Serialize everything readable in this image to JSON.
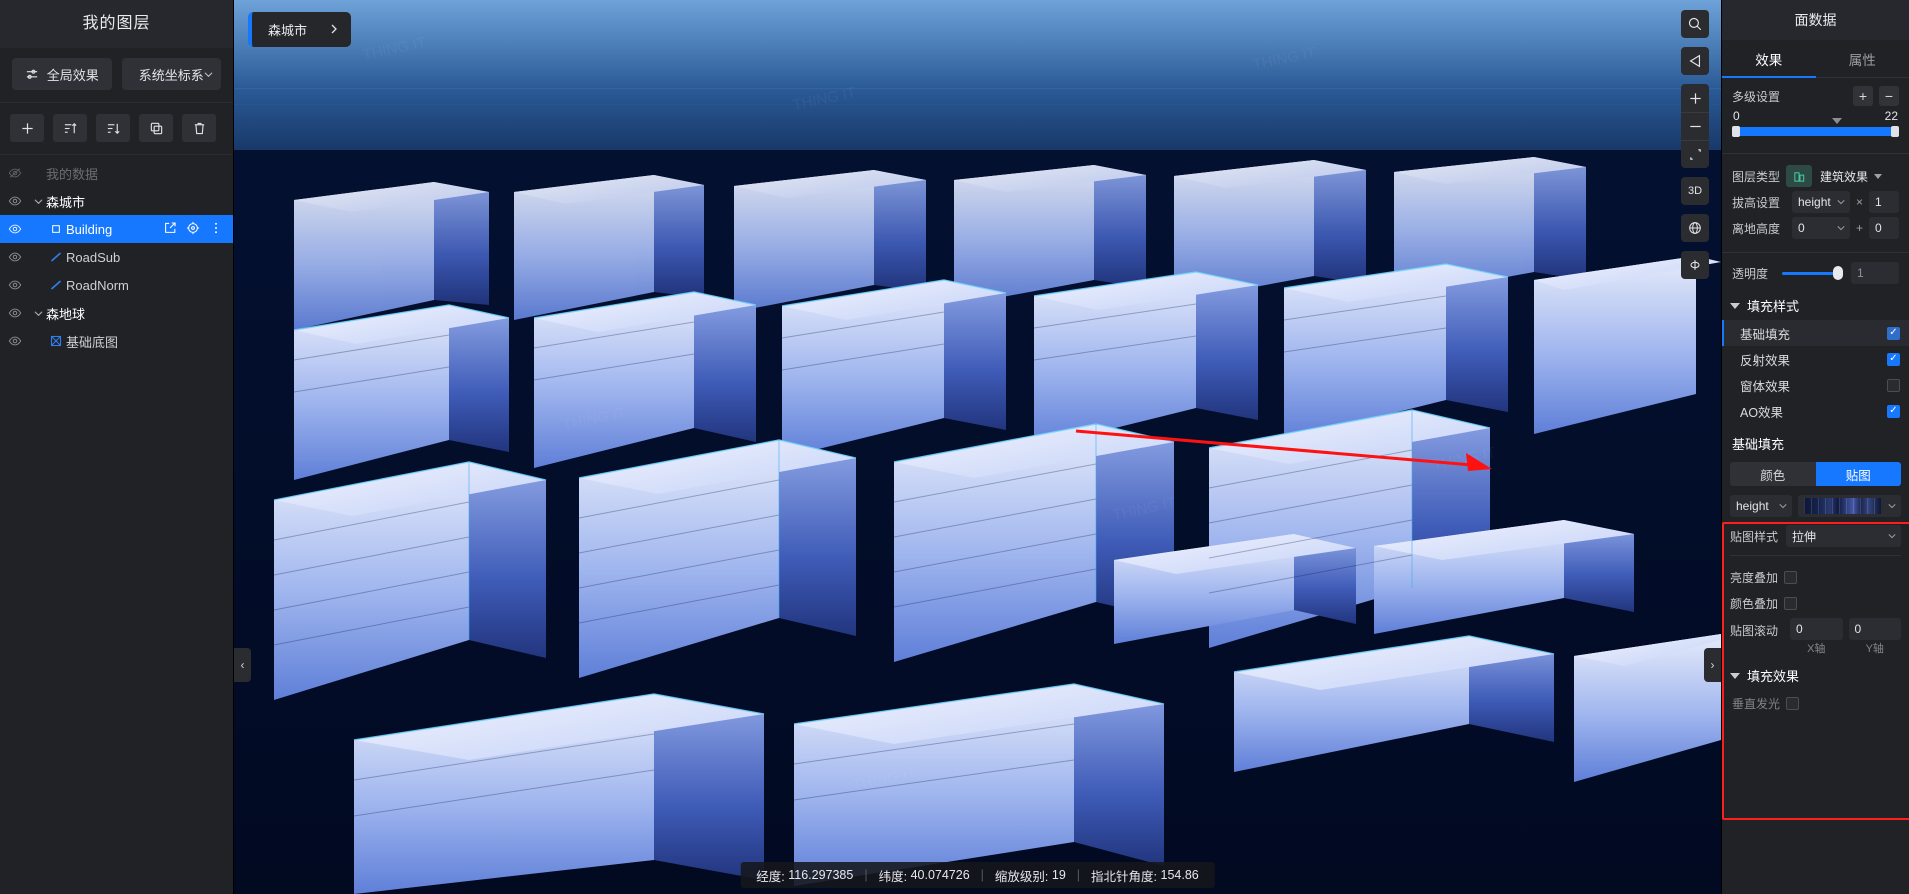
{
  "sidebar": {
    "title": "我的图层",
    "actions": [
      {
        "label": "全局效果",
        "icon": "sliders-icon"
      },
      {
        "label": "系统坐标系",
        "icon": "chevron-down-icon"
      }
    ],
    "tools": [
      {
        "name": "add-layer-button",
        "icon": "plus-icon"
      },
      {
        "name": "sort-asc-button",
        "icon": "sort-asc-icon"
      },
      {
        "name": "sort-desc-button",
        "icon": "sort-desc-icon"
      },
      {
        "name": "copy-button",
        "icon": "copy-icon"
      },
      {
        "name": "delete-button",
        "icon": "trash-icon"
      }
    ],
    "layers": [
      {
        "name": "我的数据",
        "level": 0,
        "visible": false,
        "hasCaret": false,
        "typeIcon": "none",
        "selected": false,
        "dim": true
      },
      {
        "name": "森城市",
        "level": 0,
        "visible": true,
        "hasCaret": true,
        "typeIcon": "none",
        "selected": false,
        "dim": false
      },
      {
        "name": "Building",
        "level": 1,
        "visible": true,
        "hasCaret": false,
        "typeIcon": "polygon-icon",
        "selected": true,
        "dim": false
      },
      {
        "name": "RoadSub",
        "level": 1,
        "visible": true,
        "hasCaret": false,
        "typeIcon": "line-icon",
        "selected": false,
        "dim": false
      },
      {
        "name": "RoadNorm",
        "level": 1,
        "visible": true,
        "hasCaret": false,
        "typeIcon": "line-icon",
        "selected": false,
        "dim": false
      },
      {
        "name": "森地球",
        "level": 0,
        "visible": true,
        "hasCaret": true,
        "typeIcon": "none",
        "selected": false,
        "dim": false
      },
      {
        "name": "基础底图",
        "level": 1,
        "visible": true,
        "hasCaret": false,
        "typeIcon": "raster-icon",
        "selected": false,
        "dim": false
      }
    ]
  },
  "map": {
    "breadcrumb": "森城市",
    "toolbar": [
      {
        "name": "search-icon"
      },
      {
        "name": "measure-icon"
      },
      {
        "name": "zoom-in-icon"
      },
      {
        "name": "zoom-out-icon"
      },
      {
        "name": "fullscreen-icon"
      },
      {
        "name": "3d-toggle",
        "label": "3D"
      },
      {
        "name": "globe-icon"
      },
      {
        "name": "rotate-icon"
      }
    ],
    "status": {
      "longitude_label": "经度:",
      "longitude": "116.297385",
      "latitude_label": "纬度:",
      "latitude": "40.074726",
      "zoom_label": "缩放级别:",
      "zoom": "19",
      "bearing_label": "指北针角度:",
      "bearing": "154.86"
    },
    "collapse_left": "‹",
    "collapse_right": "›"
  },
  "right_panel": {
    "title": "面数据",
    "tabs": [
      {
        "label": "效果",
        "active": true
      },
      {
        "label": "属性",
        "active": false
      }
    ],
    "multilevel": {
      "label": "多级设置",
      "add": "+",
      "remove": "−",
      "min": "0",
      "max": "22"
    },
    "layer_type": {
      "label": "图层类型",
      "value": "建筑效果",
      "icon": "building-icon"
    },
    "extrude": {
      "label": "拔高设置",
      "field": "height",
      "operator": "×",
      "value": "1"
    },
    "ground_height": {
      "label": "离地高度",
      "field": "0",
      "operator": "+",
      "value": "0"
    },
    "opacity": {
      "label": "透明度",
      "value": "1"
    },
    "fill_style": {
      "title": "填充样式",
      "items": [
        {
          "label": "基础填充",
          "checked": true,
          "selected": true
        },
        {
          "label": "反射效果",
          "checked": true,
          "selected": false
        },
        {
          "label": "窗体效果",
          "checked": false,
          "selected": false
        },
        {
          "label": "AO效果",
          "checked": true,
          "selected": false
        }
      ]
    },
    "base_fill": {
      "title": "基础填充",
      "mode_tabs": [
        {
          "label": "颜色",
          "active": false
        },
        {
          "label": "贴图",
          "active": true
        }
      ],
      "field": "height",
      "texture_preview": "gradient-strip",
      "texture_style": {
        "label": "贴图样式",
        "value": "拉伸"
      },
      "brightness_overlay": {
        "label": "亮度叠加",
        "checked": false
      },
      "color_overlay": {
        "label": "颜色叠加",
        "checked": false
      },
      "texture_scroll": {
        "label": "贴图滚动",
        "x_value": "0",
        "x_label": "X轴",
        "y_value": "0",
        "y_label": "Y轴"
      }
    },
    "fill_effect": {
      "title": "填充效果",
      "items": [
        {
          "label": "垂直发光",
          "checked": false
        }
      ]
    }
  },
  "colors": {
    "accent": "#1677ff",
    "highlight": "#ff1d1d",
    "panel_bg": "#212226",
    "map_bg": "#030a1c"
  }
}
